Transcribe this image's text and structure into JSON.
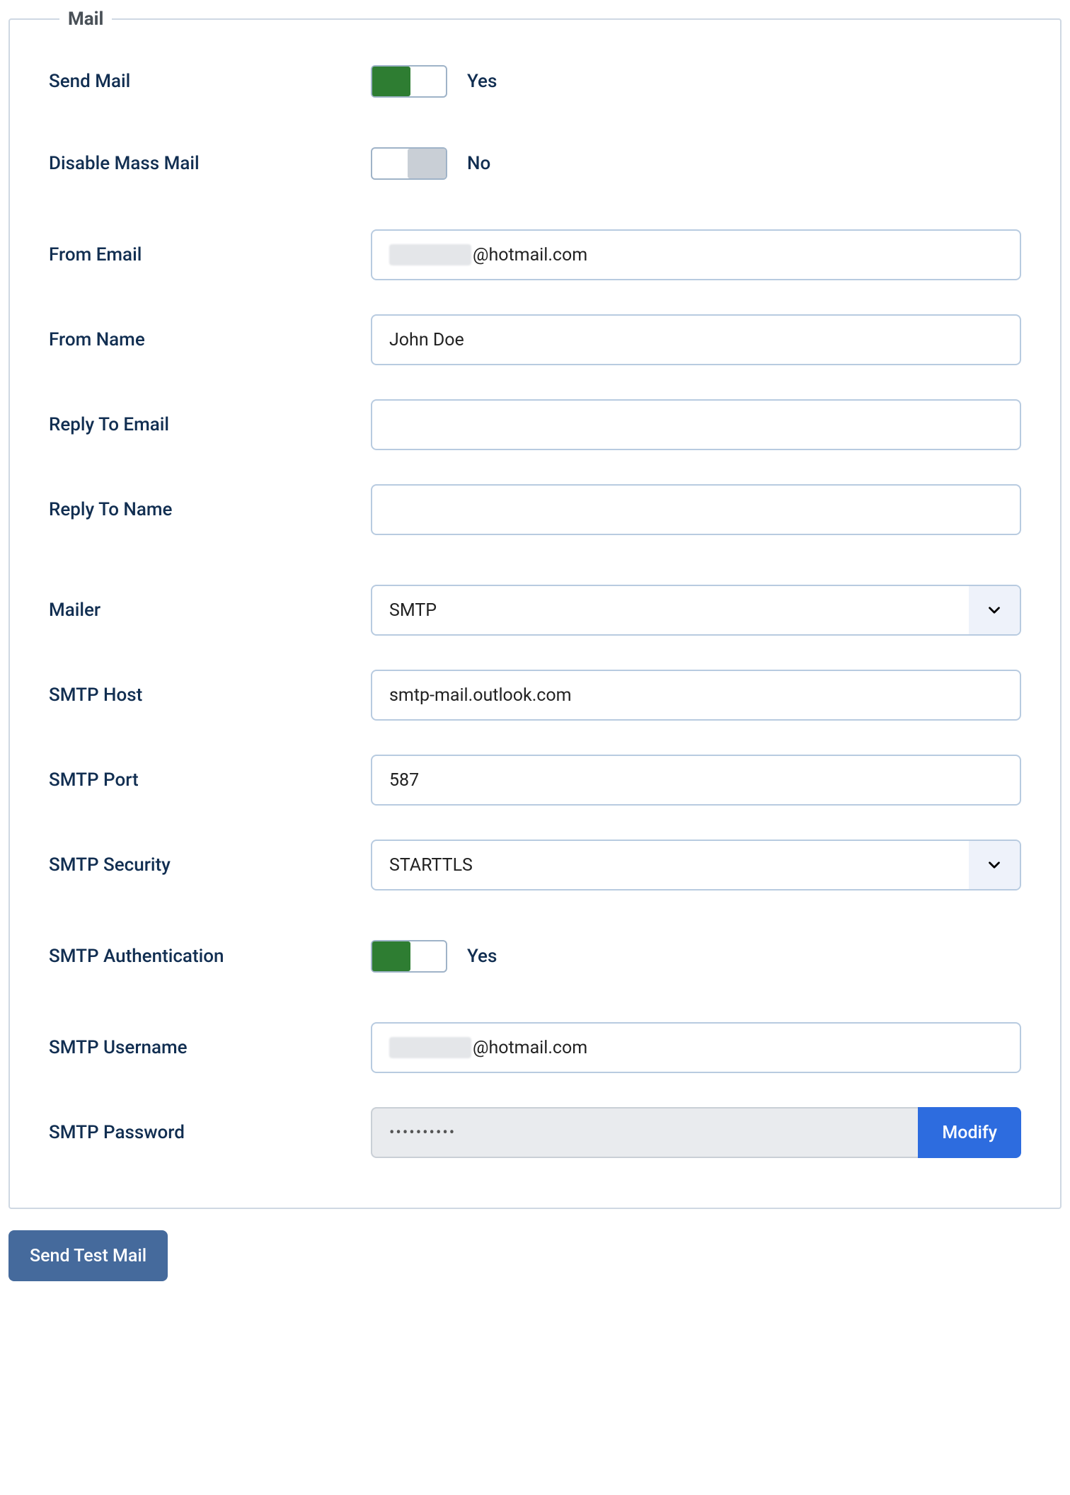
{
  "fieldset": {
    "legend": "Mail"
  },
  "labels": {
    "send_mail": "Send Mail",
    "disable_mass_mail": "Disable Mass Mail",
    "from_email": "From Email",
    "from_name": "From Name",
    "reply_to_email": "Reply To Email",
    "reply_to_name": "Reply To Name",
    "mailer": "Mailer",
    "smtp_host": "SMTP Host",
    "smtp_port": "SMTP Port",
    "smtp_security": "SMTP Security",
    "smtp_auth": "SMTP Authentication",
    "smtp_username": "SMTP Username",
    "smtp_password": "SMTP Password"
  },
  "values": {
    "send_mail_toggle": "Yes",
    "disable_mass_mail_toggle": "No",
    "from_email_suffix": "@hotmail.com",
    "from_name": "John Doe",
    "reply_to_email": "",
    "reply_to_name": "",
    "mailer": "SMTP",
    "smtp_host": "smtp-mail.outlook.com",
    "smtp_port": "587",
    "smtp_security": "STARTTLS",
    "smtp_auth_toggle": "Yes",
    "smtp_username_suffix": "@hotmail.com",
    "smtp_password_mask": "••••••••••"
  },
  "buttons": {
    "modify": "Modify",
    "send_test": "Send Test Mail"
  }
}
